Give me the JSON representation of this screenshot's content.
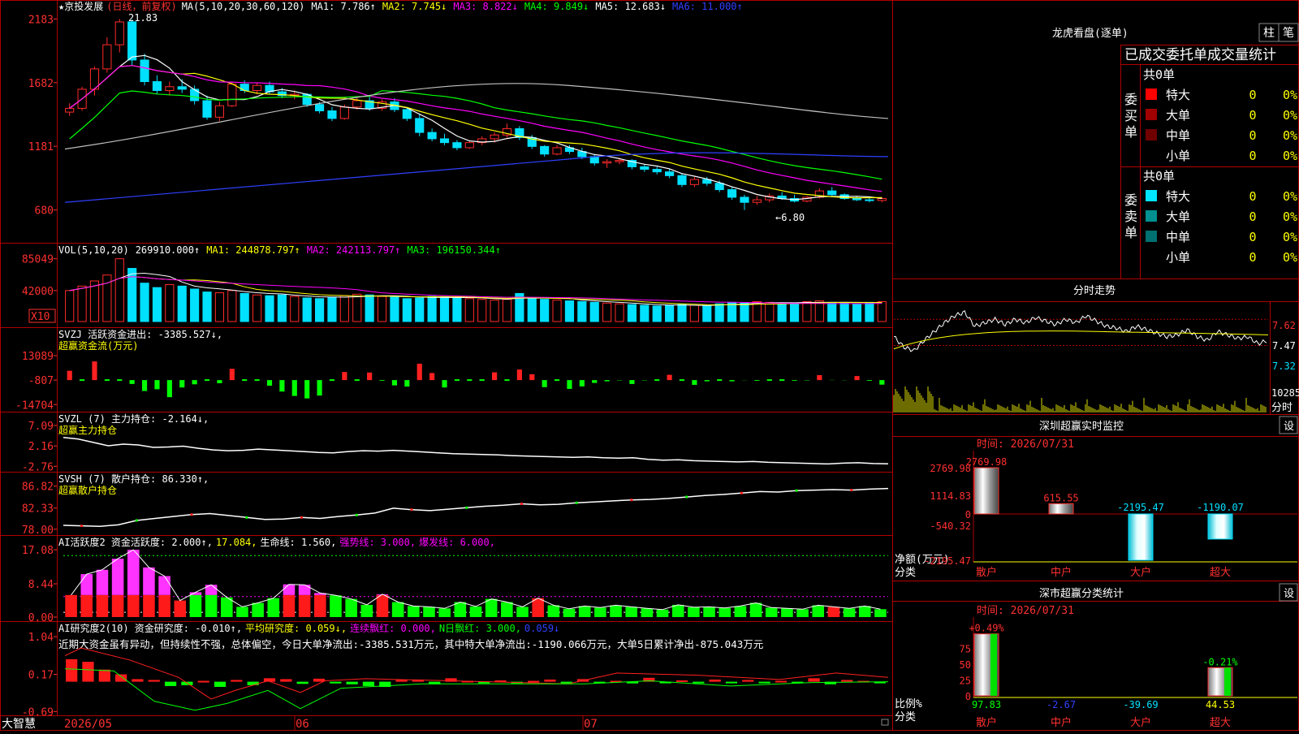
{
  "colors": {
    "up": "#ff2a2a",
    "down": "#00e0ff",
    "green": "#00ff00",
    "white": "#ffffff",
    "yellow": "#ffff00",
    "magenta": "#ff00ff",
    "blue": "#3040ff",
    "gray": "#c0c0c0",
    "frame": "#c00000"
  },
  "main": {
    "title": "★京投发展",
    "period": "(日线，前复权)",
    "ma_legend": "MA(5,10,20,30,60,120)",
    "mas": [
      {
        "label": "MA1: 7.786↑",
        "color": "#ffffff"
      },
      {
        "label": "MA2: 7.745↓",
        "color": "#ffff00"
      },
      {
        "label": "MA3: 8.822↓",
        "color": "#ff00ff"
      },
      {
        "label": "MA4: 9.849↓",
        "color": "#00ff00"
      },
      {
        "label": "MA5: 12.683↓",
        "color": "#ffffff"
      },
      {
        "label": "MA6: 11.000↑",
        "color": "#3040ff"
      }
    ],
    "axis": [
      "2183",
      "1682",
      "1181",
      "680"
    ],
    "high_note": "21.83",
    "low_note": "←6.80"
  },
  "vol": {
    "legend": "VOL(5,10,20)",
    "items": [
      {
        "label": "269910.000↑",
        "color": "#ffffff"
      },
      {
        "label": "MA1: 244878.797↑",
        "color": "#ffff00"
      },
      {
        "label": "MA2: 242113.797↑",
        "color": "#ff00ff"
      },
      {
        "label": "MA3: 196150.344↑",
        "color": "#00ff00"
      }
    ],
    "axis": [
      "85049",
      "42000"
    ],
    "unit": "X10"
  },
  "svzj": {
    "line1": "SVZJ  活跃资金进出: -3385.527↓,",
    "line2": "超赢资金流(万元)",
    "axis": [
      "13089",
      "-807",
      "-14704"
    ]
  },
  "svzl": {
    "line1": "SVZL (7) 主力持仓: -2.164↓,",
    "line2": "超赢主力持仓",
    "axis": [
      "7.09",
      "2.16",
      "-2.76"
    ]
  },
  "svsh": {
    "line1": "SVSH (7) 散户持仓: 86.330↑,",
    "line2": "超赢散户持仓",
    "axis": [
      "86.82",
      "82.33",
      "78.00"
    ]
  },
  "ai1": {
    "items": [
      {
        "label": "AI活跃度2 资金活跃度: 2.000↑,",
        "color": "#ffffff"
      },
      {
        "label": "17.084,",
        "color": "#ffff00"
      },
      {
        "label": "生命线: 1.560,",
        "color": "#ffffff"
      },
      {
        "label": "强势线: 3.000,",
        "color": "#ff00ff"
      },
      {
        "label": "爆发线: 6.000,",
        "color": "#ff00ff"
      }
    ],
    "axis": [
      "17.08",
      "8.44",
      "0.00"
    ]
  },
  "ai2": {
    "items": [
      {
        "label": "AI研究度2(10) 资金研究度: -0.010↑,",
        "color": "#ffffff"
      },
      {
        "label": "平均研究度: 0.059↓,",
        "color": "#ffff00"
      },
      {
        "label": "连续飘红: 0.000,",
        "color": "#ff00ff"
      },
      {
        "label": "N日飘红: 3.000,",
        "color": "#00ff00"
      },
      {
        "label": "0.059↓",
        "color": "#3040ff"
      }
    ],
    "comment": "近期大资金虽有异动，但持续性不强，总体偏空，今日大单净流出:-3385.531万元，其中特大单净流出:-1190.066万元，大单5日累计净出-875.043万元",
    "axis": [
      "1.04",
      "0.17",
      "-0.69"
    ]
  },
  "bottom": {
    "app_name": "大智慧",
    "dates": [
      "2026/05",
      "06",
      "07"
    ]
  },
  "longhu": {
    "title": "龙虎看盘(逐单)",
    "btn1": "柱",
    "btn2": "笔",
    "subtitle": "已成交委托单成交量统计",
    "buy_label": "委买单",
    "sell_label": "委卖单",
    "buy_total": "共0单",
    "sell_total": "共0单",
    "buy_rows": [
      {
        "name": "特大",
        "count": "0",
        "pct": "0%",
        "color": "#ff0000"
      },
      {
        "name": "大单",
        "count": "0",
        "pct": "0%",
        "color": "#a00000"
      },
      {
        "name": "中单",
        "count": "0",
        "pct": "0%",
        "color": "#700000"
      },
      {
        "name": "小单",
        "count": "0",
        "pct": "0%",
        "color": ""
      }
    ],
    "sell_rows": [
      {
        "name": "特大",
        "count": "0",
        "pct": "0%",
        "color": "#00e5ff"
      },
      {
        "name": "大单",
        "count": "0",
        "pct": "0%",
        "color": "#009090"
      },
      {
        "name": "中单",
        "count": "0",
        "pct": "0%",
        "color": "#007070"
      },
      {
        "name": "小单",
        "count": "0",
        "pct": "0%",
        "color": ""
      }
    ]
  },
  "fenshi": {
    "title": "分时走势",
    "axis": [
      "7.62",
      "7.47",
      "7.32"
    ],
    "vol_axis": "10285",
    "unit": "分时"
  },
  "sz_monitor": {
    "title": "深圳超赢实时监控",
    "set": "设",
    "time": "时间: 2026/07/31",
    "axis": [
      "2769.98",
      "1114.83",
      "0",
      "-540.32",
      "-2195.47"
    ],
    "ylabel": "净额(万元)",
    "xlabel": "分类",
    "cats": [
      "散户",
      "中户",
      "大户",
      "超大"
    ],
    "values": [
      2769.98,
      615.55,
      -2195.47,
      -1190.07
    ],
    "value_labels": [
      "2769.98",
      "615.55",
      "-2195.47",
      "-1190.07"
    ]
  },
  "sz_class": {
    "title": "深市超赢分类统计",
    "set": "设",
    "time": "时间: 2026/07/31",
    "axis": [
      "75",
      "50",
      "25",
      "0"
    ],
    "ylabel": "比例%",
    "xlabel": "分类",
    "cats": [
      "散户",
      "中户",
      "大户",
      "超大"
    ],
    "pct": [
      97.83,
      -2.67,
      -39.69,
      44.53
    ],
    "pct_labels": [
      "97.83",
      "-2.67",
      "-39.69",
      "44.53"
    ],
    "top_labels": [
      "+0.49%",
      "",
      "",
      "-0.21%"
    ]
  },
  "chart_data": [
    {
      "type": "candlestick",
      "title": "京投发展 (日线，前复权)",
      "x": [
        "2026/05",
        "06",
        "07"
      ],
      "ylim": [
        6.8,
        21.83
      ],
      "ohlc": [
        [
          14.5,
          15.2,
          14.2,
          14.8
        ],
        [
          14.8,
          16.5,
          14.6,
          16.3
        ],
        [
          16.3,
          18.1,
          15.8,
          17.9
        ],
        [
          17.9,
          20.4,
          17.6,
          19.8
        ],
        [
          19.8,
          21.83,
          19.2,
          21.6
        ],
        [
          21.6,
          21.8,
          18.2,
          18.6
        ],
        [
          18.6,
          19.1,
          16.6,
          16.9
        ],
        [
          16.9,
          17.4,
          15.9,
          16.2
        ],
        [
          16.2,
          16.9,
          15.8,
          16.5
        ],
        [
          16.5,
          17.1,
          16.0,
          16.3
        ],
        [
          16.3,
          16.6,
          15.1,
          15.4
        ],
        [
          15.4,
          15.8,
          13.9,
          14.1
        ],
        [
          14.1,
          15.3,
          13.8,
          15.0
        ],
        [
          15.0,
          16.9,
          14.9,
          16.7
        ],
        [
          16.7,
          17.0,
          16.0,
          16.2
        ],
        [
          16.2,
          16.8,
          15.9,
          16.6
        ],
        [
          16.6,
          16.9,
          15.9,
          16.1
        ],
        [
          16.1,
          16.4,
          15.6,
          15.8
        ],
        [
          15.8,
          16.2,
          15.5,
          15.9
        ],
        [
          15.9,
          16.0,
          14.9,
          15.1
        ],
        [
          15.1,
          15.3,
          14.4,
          14.6
        ],
        [
          14.6,
          14.9,
          13.8,
          14.0
        ],
        [
          14.0,
          15.1,
          13.9,
          14.9
        ],
        [
          14.9,
          15.7,
          14.7,
          15.4
        ],
        [
          15.4,
          15.7,
          14.6,
          14.8
        ],
        [
          14.8,
          15.5,
          14.6,
          15.3
        ],
        [
          15.3,
          15.6,
          14.5,
          14.7
        ],
        [
          14.7,
          14.9,
          13.8,
          14.0
        ],
        [
          14.0,
          14.4,
          12.6,
          12.9
        ],
        [
          12.9,
          13.2,
          12.2,
          12.4
        ],
        [
          12.4,
          12.8,
          11.9,
          12.1
        ],
        [
          12.1,
          12.3,
          11.5,
          11.7
        ],
        [
          11.7,
          12.2,
          11.6,
          12.1
        ],
        [
          12.1,
          12.6,
          11.9,
          12.4
        ],
        [
          12.4,
          12.9,
          12.1,
          12.7
        ],
        [
          12.7,
          13.6,
          12.5,
          13.2
        ],
        [
          13.2,
          13.4,
          12.3,
          12.5
        ],
        [
          12.5,
          12.7,
          11.6,
          11.8
        ],
        [
          11.8,
          11.9,
          11.0,
          11.2
        ],
        [
          11.2,
          11.9,
          11.1,
          11.7
        ],
        [
          11.7,
          11.9,
          11.2,
          11.4
        ],
        [
          11.4,
          11.7,
          10.8,
          11.0
        ],
        [
          11.0,
          11.2,
          10.3,
          10.5
        ],
        [
          10.5,
          10.8,
          10.1,
          10.6
        ],
        [
          10.6,
          10.9,
          10.4,
          10.7
        ],
        [
          10.7,
          10.8,
          10.0,
          10.2
        ],
        [
          10.2,
          10.4,
          9.8,
          10.0
        ],
        [
          10.0,
          10.2,
          9.6,
          9.8
        ],
        [
          9.8,
          10.0,
          9.3,
          9.5
        ],
        [
          9.5,
          9.7,
          8.6,
          8.8
        ],
        [
          8.8,
          9.4,
          8.6,
          9.2
        ],
        [
          9.2,
          9.4,
          8.7,
          8.9
        ],
        [
          8.9,
          9.1,
          8.2,
          8.4
        ],
        [
          8.4,
          8.6,
          7.6,
          7.8
        ],
        [
          7.8,
          8.0,
          6.8,
          7.4
        ],
        [
          7.4,
          7.9,
          7.2,
          7.6
        ],
        [
          7.6,
          8.1,
          7.4,
          7.9
        ],
        [
          7.9,
          8.2,
          7.6,
          7.7
        ],
        [
          7.7,
          8.0,
          7.4,
          7.5
        ],
        [
          7.5,
          7.9,
          7.4,
          7.8
        ],
        [
          7.8,
          8.5,
          7.7,
          8.3
        ],
        [
          8.3,
          8.6,
          7.9,
          8.0
        ],
        [
          8.0,
          8.1,
          7.6,
          7.7
        ],
        [
          7.7,
          7.9,
          7.5,
          7.6
        ],
        [
          7.6,
          7.8,
          7.4,
          7.55
        ],
        [
          7.55,
          7.8,
          7.4,
          7.7
        ]
      ]
    },
    {
      "type": "bar",
      "title": "VOL(5,10,20)",
      "ylim": [
        0,
        85049
      ],
      "values": [
        42000,
        48000,
        55000,
        63000,
        85049,
        72000,
        52000,
        46000,
        50000,
        48000,
        44000,
        40000,
        39000,
        42000,
        38000,
        36000,
        35000,
        36000,
        34000,
        32000,
        31000,
        33000,
        35000,
        37000,
        36000,
        34000,
        33000,
        31000,
        32000,
        34000,
        33000,
        32000,
        31000,
        30000,
        29000,
        30000,
        38000,
        32000,
        30000,
        29000,
        28000,
        27000,
        26000,
        25000,
        24000,
        23000,
        22000,
        21000,
        22000,
        23000,
        22000,
        21000,
        24000,
        26000,
        25000,
        27000,
        26000,
        24000,
        25000,
        27000,
        28000,
        26000,
        25000,
        24000,
        26000,
        27000
      ]
    },
    {
      "type": "bar",
      "title": "SVZJ 活跃资金进出 (万元)",
      "ylim": [
        -14704,
        13089
      ],
      "values": [
        4500,
        0,
        9800,
        0,
        0,
        -3000,
        -7000,
        -6000,
        -10500,
        -5000,
        -3200,
        0,
        -2600,
        5600,
        0,
        0,
        -4000,
        -7300,
        -9800,
        -11200,
        -9600,
        0,
        3800,
        0,
        3500,
        -1200,
        -3800,
        -4500,
        8500,
        3200,
        -5000,
        0,
        0,
        0,
        3600,
        0,
        5200,
        2500,
        -4800,
        0,
        -5800,
        -4400,
        -2400,
        -1500,
        -1000,
        -3000,
        -1000,
        0,
        2200,
        0,
        -3500,
        -1500,
        0,
        -1500,
        -900,
        -1200,
        0,
        0,
        -1200,
        -1000,
        2000,
        -700,
        -900,
        1500,
        -1200,
        -3385
      ]
    },
    {
      "type": "line",
      "title": "SVZL (7) 主力持仓",
      "ylim": [
        -2.76,
        7.09
      ],
      "values": [
        4.2,
        3.8,
        3.0,
        2.2,
        2.6,
        2.4,
        1.8,
        1.9,
        2.1,
        1.6,
        1.2,
        1.0,
        1.1,
        1.4,
        1.2,
        1.0,
        0.8,
        0.6,
        0.5,
        0.8,
        1.0,
        0.9,
        1.1,
        0.9,
        0.7,
        0.5,
        0.3,
        0.2,
        0.1,
        0.0,
        -0.2,
        -0.3,
        -0.4,
        -0.5,
        -0.6,
        -0.5,
        -0.7,
        -0.8,
        -0.7,
        -1.1,
        -1.3,
        -1.2,
        -1.4,
        -1.5,
        -1.6,
        -1.7,
        -1.6,
        -1.8,
        -1.9,
        -2.0,
        -2.1,
        -2.2,
        -2.0,
        -1.9,
        -2.1,
        -2.164
      ]
    },
    {
      "type": "line",
      "title": "SVSH (7) 散户持仓",
      "ylim": [
        78.0,
        86.82
      ],
      "values": [
        78.8,
        78.7,
        78.6,
        78.9,
        79.8,
        80.2,
        80.6,
        81.0,
        81.2,
        80.8,
        80.4,
        80.0,
        80.1,
        80.4,
        80.2,
        80.6,
        80.9,
        81.3,
        82.3,
        82.0,
        81.8,
        82.1,
        82.4,
        82.7,
        82.9,
        83.2,
        83.0,
        83.1,
        83.4,
        83.6,
        83.8,
        84.0,
        84.1,
        84.3,
        84.6,
        84.9,
        85.1,
        85.4,
        85.7,
        85.6,
        85.9,
        86.0,
        86.1,
        86.0,
        86.2,
        86.33
      ]
    },
    {
      "type": "bar",
      "title": "AI活跃度2",
      "ylim": [
        0,
        17.08
      ],
      "values": [
        5.6,
        10.9,
        12.0,
        14.8,
        17.08,
        12.6,
        10.4,
        4.2,
        6.3,
        8.2,
        5.0,
        2.6,
        3.6,
        4.8,
        8.3,
        8.2,
        6.1,
        5.5,
        4.6,
        3.1,
        5.8,
        3.8,
        2.8,
        2.6,
        2.2,
        3.8,
        2.7,
        4.6,
        3.8,
        2.6,
        4.8,
        3.0,
        2.1,
        2.8,
        2.4,
        3.0,
        2.6,
        2.2,
        1.9,
        3.1,
        2.5,
        2.6,
        2.3,
        2.8,
        3.6,
        2.4,
        2.2,
        2.0,
        3.0,
        2.6,
        2.2,
        2.8,
        2.0
      ]
    },
    {
      "type": "bar",
      "title": "AI研究度2(10)",
      "ylim": [
        -0.69,
        1.04
      ],
      "values": [
        0.52,
        0.46,
        0.28,
        0.17,
        0.06,
        0.04,
        -0.1,
        -0.08,
        0.02,
        -0.12,
        0.04,
        -0.08,
        0.08,
        0.06,
        -0.05,
        0.07,
        -0.04,
        -0.06,
        -0.1,
        -0.12,
        0.04,
        0.05,
        -0.06,
        0.08,
        0.02,
        -0.03,
        0.03,
        -0.04,
        0.02,
        0.05,
        -0.02,
        0.06,
        -0.01,
        0.02,
        -0.04,
        0.09,
        -0.03,
        0.03,
        -0.01,
        0.05,
        -0.02,
        0.04,
        -0.01,
        0.02,
        -0.03,
        0.08,
        -0.06,
        0.04,
        0.02,
        -0.01
      ]
    },
    {
      "type": "line",
      "title": "分时走势",
      "ylim": [
        7.32,
        7.62
      ],
      "values": [
        7.52,
        7.46,
        7.44,
        7.5,
        7.55,
        7.6,
        7.64,
        7.66,
        7.58,
        7.6,
        7.62,
        7.59,
        7.62,
        7.6,
        7.63,
        7.61,
        7.59,
        7.62,
        7.6,
        7.64,
        7.61,
        7.58,
        7.57,
        7.55,
        7.58,
        7.56,
        7.54,
        7.52,
        7.53,
        7.56,
        7.52,
        7.5,
        7.55,
        7.53,
        7.51,
        7.52,
        7.48,
        7.5
      ]
    },
    {
      "type": "bar",
      "title": "深圳超赢实时监控",
      "categories": [
        "散户",
        "中户",
        "大户",
        "超大"
      ],
      "values": [
        2769.98,
        615.55,
        -2195.47,
        -1190.07
      ],
      "ylabel": "净额(万元)",
      "xlabel": "分类"
    },
    {
      "type": "bar",
      "title": "深市超赢分类统计",
      "categories": [
        "散户",
        "中户",
        "大户",
        "超大"
      ],
      "values": [
        97.83,
        -2.67,
        -39.69,
        44.53
      ],
      "ylabel": "比例%",
      "xlabel": "分类"
    }
  ]
}
